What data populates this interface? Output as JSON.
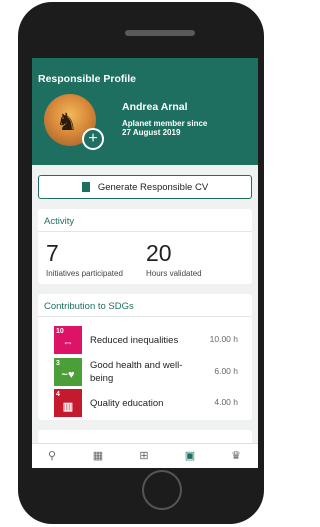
{
  "header": {
    "title": "Responsible Profile",
    "name": "Andrea Arnal",
    "member_line1": "Aplanet member since",
    "member_line2": "27 August 2019"
  },
  "cv_button": {
    "label": "Generate Responsible CV"
  },
  "activity": {
    "title": "Activity",
    "stats": [
      {
        "value": "7",
        "label": "Initiatives participated"
      },
      {
        "value": "20",
        "label": "Hours validated"
      }
    ]
  },
  "sdgs": {
    "title": "Contribution to SDGs",
    "items": [
      {
        "number": "10",
        "icon_text": "REDUCED INEQUALITIES",
        "label": "Reduced inequalities",
        "hours": "10.00 h",
        "color": "#dd1367"
      },
      {
        "number": "3",
        "icon_text": "GOOD HEALTH AND WELL-BEING",
        "label": "Good health and well-being",
        "hours": "6.00 h",
        "color": "#4c9f38"
      },
      {
        "number": "4",
        "icon_text": "QUALITY EDUCATION",
        "label": "Quality education",
        "hours": "4.00 h",
        "color": "#c5192d"
      }
    ]
  },
  "colors": {
    "brand": "#1f6f61"
  },
  "nav": {
    "items": [
      "search-icon",
      "calendar-icon",
      "add-icon",
      "profile-icon",
      "trophy-icon"
    ],
    "active": "profile-icon"
  }
}
